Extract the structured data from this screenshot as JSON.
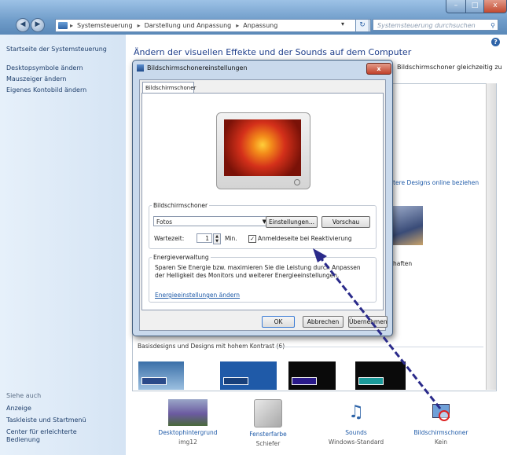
{
  "window": {
    "controls": {
      "min": "–",
      "max": "□",
      "close": "x"
    }
  },
  "address": {
    "crumbs": [
      "Systemsteuerung",
      "Darstellung und Anpassung",
      "Anpassung"
    ],
    "search_placeholder": "Systemsteuerung durchsuchen"
  },
  "sidebar": {
    "home": "Startseite der Systemsteuerung",
    "items": [
      "Desktopsymbole ändern",
      "Mauszeiger ändern",
      "Eigenes Kontobild ändern"
    ],
    "see_also_title": "Siehe auch",
    "see_also": [
      "Anzeige",
      "Taskleiste und Startmenü",
      "Center für erleichterte\nBedienung"
    ]
  },
  "main": {
    "title": "Ändern der visuellen Effekte und der Sounds auf dem Computer",
    "subtitle_fragment": "Bildschirmschoner gleichzeitig zu",
    "online_link": "itere Designs online beziehen",
    "theme_fragment": "haften",
    "basis_header": "Basisdesigns und Designs mit hohem Kontrast (6)",
    "bottom": [
      {
        "label": "Desktophintergrund",
        "value": "img12"
      },
      {
        "label": "Fensterfarbe",
        "value": "Schiefer"
      },
      {
        "label": "Sounds",
        "value": "Windows-Standard"
      },
      {
        "label": "Bildschirmschoner",
        "value": "Kein"
      }
    ]
  },
  "dialog": {
    "title": "Bildschirmschonereinstellungen",
    "tab": "Bildschirmschoner",
    "group_screensaver": "Bildschirmschoner",
    "selected": "Fotos",
    "settings_btn": "Einstellungen...",
    "preview_btn": "Vorschau",
    "wait_label": "Wartezeit:",
    "wait_value": "1",
    "wait_unit": "Min.",
    "resume_checkbox": "Anmeldeseite bei Reaktivierung",
    "resume_checked": true,
    "group_energy": "Energieverwaltung",
    "energy_text": "Sparen Sie Energie bzw. maximieren Sie die Leistung durch Anpassen der Helligkeit des Monitors und weiterer Energieeinstellungen.",
    "energy_link": "Energieeinstellungen ändern",
    "ok": "OK",
    "cancel": "Abbrechen",
    "apply": "Übernehmen"
  },
  "colors": {
    "accent": "#1e5aa8",
    "arrow": "#2a2a8a"
  }
}
